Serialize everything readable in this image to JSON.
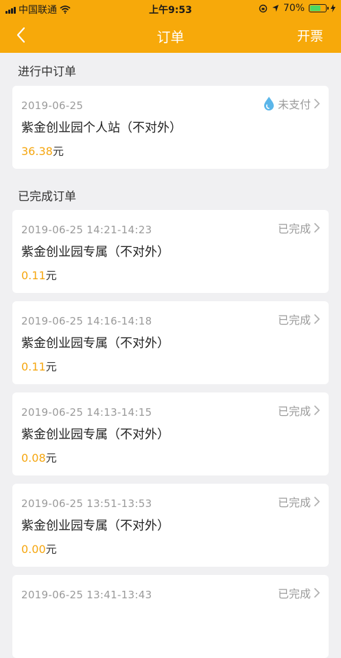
{
  "status_bar": {
    "carrier": "中国联通",
    "time": "上午9:53",
    "battery": "70%",
    "battery_level": 0.7
  },
  "nav": {
    "title": "订单",
    "action": "开票"
  },
  "sections": {
    "ongoing_title": "进行中订单",
    "completed_title": "已完成订单"
  },
  "ongoing_orders": [
    {
      "date": "2019-06-25",
      "status": "未支付",
      "name": "紫金创业园个人站（不对外）",
      "price": "36.38",
      "unit": "元"
    }
  ],
  "completed_orders": [
    {
      "date": "2019-06-25  14:21-14:23",
      "status": "已完成",
      "name": "紫金创业园专属（不对外）",
      "price": "0.11",
      "unit": "元"
    },
    {
      "date": "2019-06-25  14:16-14:18",
      "status": "已完成",
      "name": "紫金创业园专属（不对外）",
      "price": "0.11",
      "unit": "元"
    },
    {
      "date": "2019-06-25  14:13-14:15",
      "status": "已完成",
      "name": "紫金创业园专属（不对外）",
      "price": "0.08",
      "unit": "元"
    },
    {
      "date": "2019-06-25  13:51-13:53",
      "status": "已完成",
      "name": "紫金创业园专属（不对外）",
      "price": "0.00",
      "unit": "元"
    },
    {
      "date": "2019-06-25  13:41-13:43",
      "status": "已完成",
      "name": "",
      "price": "",
      "unit": ""
    }
  ]
}
